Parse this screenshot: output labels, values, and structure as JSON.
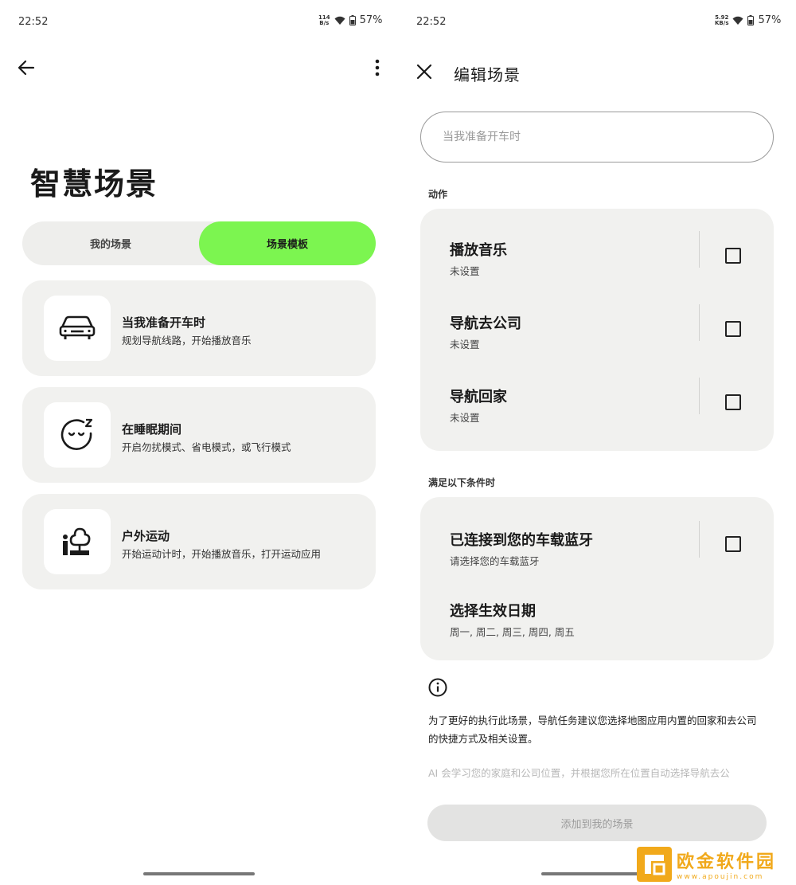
{
  "left": {
    "status": {
      "time": "22:52",
      "net_rate_top": "114",
      "net_rate_bottom": "B/s",
      "battery": "57%"
    },
    "header": {
      "back_icon": "arrow-left-icon",
      "menu_icon": "more-vertical-icon"
    },
    "title": "智慧场景",
    "tabs": [
      {
        "label": "我的场景",
        "active": false
      },
      {
        "label": "场景模板",
        "active": true
      }
    ],
    "accent_color": "#7cf550",
    "templates": [
      {
        "icon": "car-icon",
        "title": "当我准备开车时",
        "subtitle": "规划导航线路，开始播放音乐"
      },
      {
        "icon": "sleep-face-icon",
        "title": "在睡眠期间",
        "subtitle": "开启勿扰模式、省电模式，或飞行模式"
      },
      {
        "icon": "outdoor-tree-icon",
        "title": "户外运动",
        "subtitle": "开始运动计时，开始播放音乐，打开运动应用"
      }
    ]
  },
  "right": {
    "status": {
      "time": "22:52",
      "net_rate_top": "5.92",
      "net_rate_bottom": "KB/s",
      "battery": "57%"
    },
    "header": {
      "close_icon": "close-icon",
      "title": "编辑场景"
    },
    "name_input": {
      "value": "",
      "placeholder": "当我准备开车时"
    },
    "actions_label": "动作",
    "actions": [
      {
        "title": "播放音乐",
        "subtitle": "未设置",
        "checked": false
      },
      {
        "title": "导航去公司",
        "subtitle": "未设置",
        "checked": false
      },
      {
        "title": "导航回家",
        "subtitle": "未设置",
        "checked": false
      }
    ],
    "conditions_label": "满足以下条件时",
    "conditions": [
      {
        "title": "已连接到您的车载蓝牙",
        "subtitle": "请选择您的车载蓝牙",
        "checked": false
      },
      {
        "title": "选择生效日期",
        "subtitle": "周一, 周二, 周三, 周四, 周五"
      }
    ],
    "info_icon": "info-icon",
    "info_text": "为了更好的执行此场景，导航任务建议您选择地图应用内置的回家和去公司的快捷方式及相关设置。",
    "info_text_faded": "AI 会学习您的家庭和公司位置，并根据您所在位置自动选择导航去公",
    "add_button": "添加到我的场景"
  },
  "watermark": {
    "title": "欧金软件园",
    "url": "www.apoujin.com"
  }
}
